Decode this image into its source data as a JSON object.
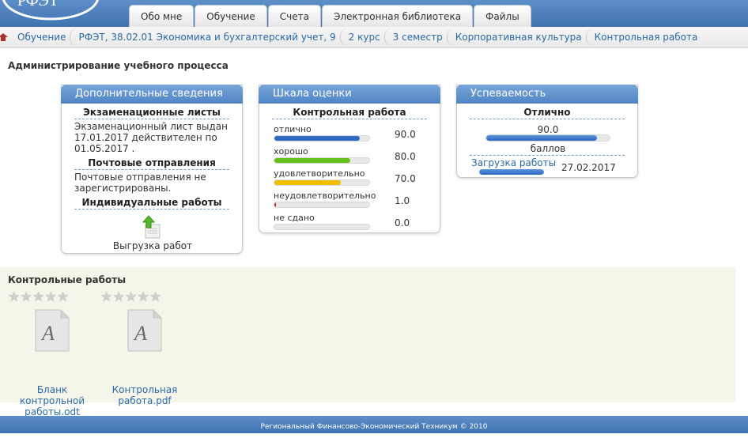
{
  "header": {
    "tabs": [
      {
        "label": "Обо мне"
      },
      {
        "label": "Обучение"
      },
      {
        "label": "Счета"
      },
      {
        "label": "Электронная библиотека"
      },
      {
        "label": "Файлы"
      }
    ],
    "logo_text": "РФЭТ"
  },
  "breadcrumb": [
    "Обучение",
    "РФЭТ, 38.02.01 Экономика и бухгалтерский учет, 9",
    "2 курс",
    "3 семестр",
    "Корпоративная культура",
    "Контрольная работа"
  ],
  "page_heading": "Администрирование учебного процесса",
  "info_panel": {
    "title": "Дополнительные сведения",
    "exam_title": "Экзаменационные листы",
    "exam_text": "Экзаменационный лист выдан 17.01.2017 действителен по 01.05.2017 .",
    "mail_title": "Почтовые отправления",
    "mail_text": "Почтовые отправления не зарегистрированы.",
    "individual_title": "Индивидуальные работы",
    "upload_icon": "upload-document-icon",
    "upload_label": "Выгрузка работ"
  },
  "scale_panel": {
    "title": "Шкала оценки",
    "subtitle": "Контрольная работа",
    "rows": [
      {
        "label": "отлично",
        "value": "90.0",
        "fill": 0.9,
        "color": "#2f6cc0"
      },
      {
        "label": "хорошо",
        "value": "80.0",
        "fill": 0.8,
        "color": "#66c01c"
      },
      {
        "label": "удовлетворительно",
        "value": "70.0",
        "fill": 0.7,
        "color": "#f0c000"
      },
      {
        "label": "неудовлетворительно",
        "value": "1.0",
        "fill": 0.01,
        "color": "#d02020"
      },
      {
        "label": "не сдано",
        "value": "0.0",
        "fill": 0.0,
        "color": "#999999"
      }
    ]
  },
  "grade_panel": {
    "title": "Успеваемость",
    "grade": "Отлично",
    "value": "90.0",
    "fill": 0.9,
    "points_label": "баллов",
    "upload_link": "Загрузка работы",
    "upload_date": "27.02.2017",
    "upload_fill": 1.0
  },
  "works": {
    "title": "Контрольные работы",
    "items": [
      {
        "name": "Бланк контрольной работы.odt",
        "stars": 0,
        "icon": "document-icon"
      },
      {
        "name": "Контрольная работа.pdf",
        "stars": 0,
        "icon": "document-icon"
      }
    ]
  },
  "footer": {
    "text": "Региональный Финансово-Экономический Техникум © 2010"
  }
}
